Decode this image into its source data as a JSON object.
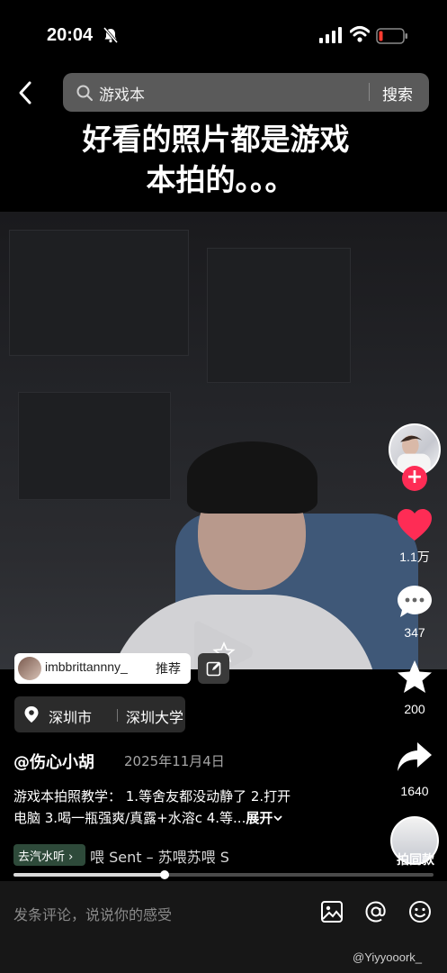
{
  "status_bar": {
    "time": "20:04",
    "bell_icon": "bell-muted-icon"
  },
  "search": {
    "value": "游戏本",
    "button_label": "搜索"
  },
  "caption": {
    "line1": "好看的照片都是游戏",
    "line2": "本拍的。。。"
  },
  "rail": {
    "likes": "1.1万",
    "comments": "347",
    "favorites": "200",
    "shares": "1640",
    "same_shot_label": "拍同款"
  },
  "recommend": {
    "username": "imbbrittannny_",
    "tag": "推荐"
  },
  "location": {
    "city": "深圳市",
    "place": "深圳大学"
  },
  "post": {
    "author": "@伤心小胡",
    "date": "2025年11月4日",
    "desc_line1": "游戏本拍照教学： 1.等舍友都没动静了 2.打开",
    "desc_line2": "电脑 3.喝一瓶强爽/真露+水溶c 4.等...",
    "expand_label": "展开"
  },
  "music": {
    "chip": "去汽水听 ›",
    "track": "喂   Sent – 苏喂苏喂   S"
  },
  "progress": {
    "fraction": 0.36
  },
  "comment_bar": {
    "placeholder": "发条评论，说说你的感受"
  },
  "watermark": "@Yiyyooork_",
  "colors": {
    "like": "#fe2c55",
    "follow": "#fe2c55",
    "search_bg": "#5a5a5a"
  }
}
